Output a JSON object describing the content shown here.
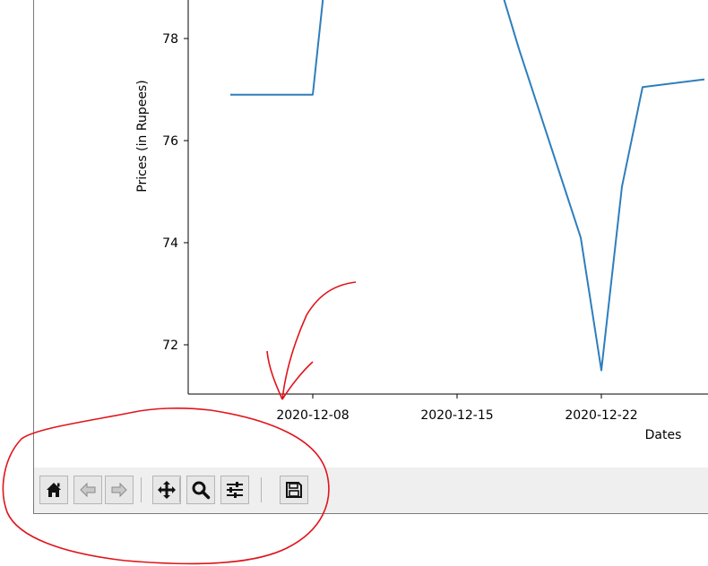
{
  "toolbar": {
    "buttons": [
      {
        "id": "home",
        "icon": "home-icon"
      },
      {
        "id": "back",
        "icon": "arrow-left-icon"
      },
      {
        "id": "forward",
        "icon": "arrow-right-icon"
      },
      {
        "id": "pan",
        "icon": "move-icon"
      },
      {
        "id": "zoom",
        "icon": "zoom-icon"
      },
      {
        "id": "configure",
        "icon": "sliders-icon"
      },
      {
        "id": "save",
        "icon": "save-icon"
      }
    ]
  },
  "chart_data": {
    "type": "line",
    "xlabel": "Dates",
    "ylabel": "Prices (in Rupees)",
    "x_ticks": [
      "2020-12-08",
      "2020-12-15",
      "2020-12-22"
    ],
    "y_ticks": [
      "72",
      "74",
      "76",
      "78"
    ],
    "ylim": [
      71.0,
      78.8
    ],
    "xlim": [
      "2020-12-02",
      "2020-12-27"
    ],
    "grid": false,
    "color": "#2e7ebc",
    "series": [
      {
        "points": [
          {
            "x": "2020-12-04",
            "y": 76.9
          },
          {
            "x": "2020-12-08",
            "y": 76.9
          },
          {
            "x": "2020-12-08 12:00",
            "y": 78.8
          },
          {
            "x": "2020-12-17 06:00",
            "y": 78.8
          },
          {
            "x": "2020-12-18",
            "y": 77.8
          },
          {
            "x": "2020-12-21",
            "y": 74.1
          },
          {
            "x": "2020-12-22",
            "y": 71.5
          },
          {
            "x": "2020-12-23",
            "y": 75.1
          },
          {
            "x": "2020-12-24",
            "y": 77.05
          },
          {
            "x": "2020-12-27",
            "y": 77.2
          }
        ]
      }
    ]
  }
}
